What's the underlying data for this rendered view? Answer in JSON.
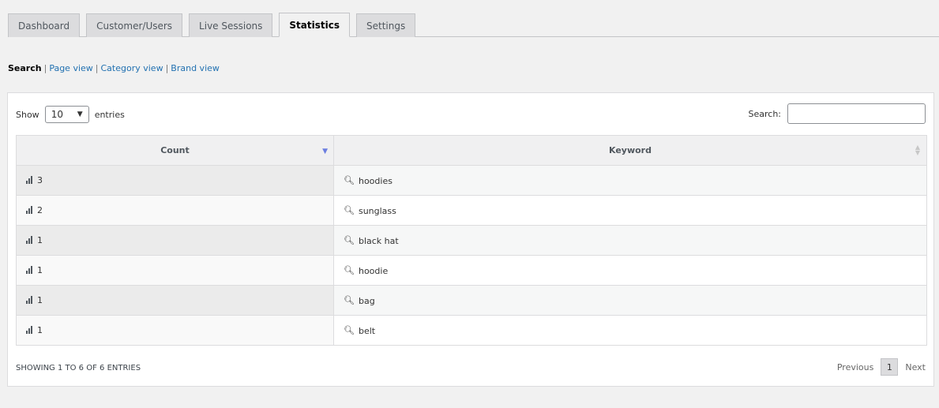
{
  "tabs": [
    {
      "label": "Dashboard"
    },
    {
      "label": "Customer/Users"
    },
    {
      "label": "Live Sessions"
    },
    {
      "label": "Statistics"
    },
    {
      "label": "Settings"
    }
  ],
  "active_tab": "Statistics",
  "subnav": {
    "current": "Search",
    "links": [
      "Page view",
      "Category view",
      "Brand view"
    ]
  },
  "table_controls": {
    "show_label": "Show",
    "page_length": "10",
    "entries_label": "entries",
    "search_label": "Search:",
    "search_value": ""
  },
  "table": {
    "columns": [
      "Count",
      "Keyword"
    ],
    "rows": [
      {
        "count": "3",
        "keyword": "hoodies"
      },
      {
        "count": "2",
        "keyword": "sunglass"
      },
      {
        "count": "1",
        "keyword": "black hat"
      },
      {
        "count": "1",
        "keyword": "hoodie"
      },
      {
        "count": "1",
        "keyword": "bag"
      },
      {
        "count": "1",
        "keyword": "belt"
      }
    ]
  },
  "footer": {
    "info": "Showing 1 to 6 of 6 entries",
    "previous": "Previous",
    "page": "1",
    "next": "Next"
  }
}
